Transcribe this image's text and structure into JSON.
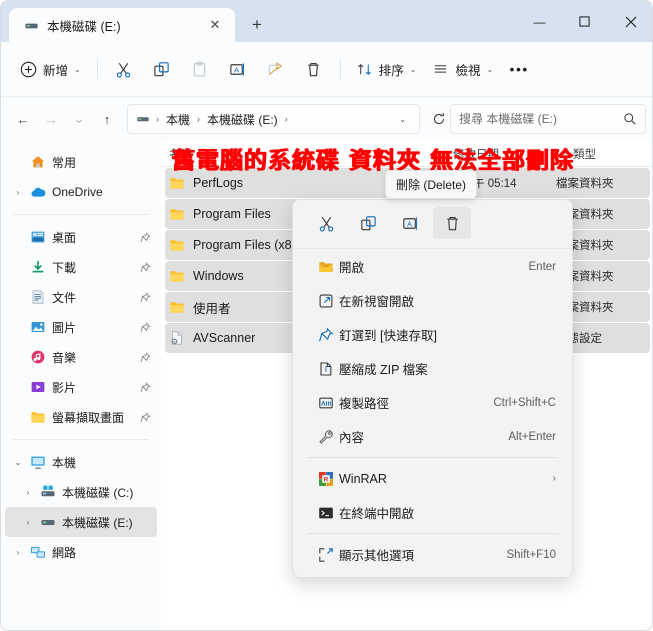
{
  "window": {
    "tab_title": "本機磁碟 (E:)",
    "tab_icon": "drive-icon",
    "close_tab_label": "✕",
    "new_tab_label": "+",
    "minimize_label": "—",
    "maximize_label": "☐",
    "close_label": "✕"
  },
  "toolbar": {
    "new_label": "新增",
    "cut_icon": "scissors-icon",
    "copy_icon": "copy-icon",
    "paste_icon": "paste-icon",
    "rename_icon": "rename-icon",
    "share_icon": "share-icon",
    "delete_icon": "trash-icon",
    "sort_label": "排序",
    "view_label": "檢視",
    "more_label": "•••",
    "caret": "⌄"
  },
  "address": {
    "back": "←",
    "forward": "→",
    "recent": "⌄",
    "up": "↑",
    "crumbs": [
      "本機",
      "本機磁碟 (E:)"
    ],
    "crumb_sep": "›",
    "dropdown": "⌄",
    "refresh": "⟳",
    "search_placeholder": "搜尋 本機磁碟 (E:)",
    "search_value": "",
    "search_icon": "magnifier-icon"
  },
  "sidebar": {
    "groups": [
      {
        "items": [
          {
            "label": "常用",
            "icon": "home-icon",
            "chevron": "",
            "pin": false,
            "selected": false,
            "indent": 0
          },
          {
            "label": "OneDrive",
            "icon": "onedrive-icon",
            "chevron": "›",
            "pin": false,
            "selected": false,
            "indent": 0
          }
        ]
      },
      {
        "items": [
          {
            "label": "桌面",
            "icon": "desktop-icon",
            "chevron": "",
            "pin": true,
            "selected": false,
            "indent": 0
          },
          {
            "label": "下載",
            "icon": "download-icon",
            "chevron": "",
            "pin": true,
            "selected": false,
            "indent": 0
          },
          {
            "label": "文件",
            "icon": "documents-icon",
            "chevron": "",
            "pin": true,
            "selected": false,
            "indent": 0
          },
          {
            "label": "圖片",
            "icon": "pictures-icon",
            "chevron": "",
            "pin": true,
            "selected": false,
            "indent": 0
          },
          {
            "label": "音樂",
            "icon": "music-icon",
            "chevron": "",
            "pin": true,
            "selected": false,
            "indent": 0
          },
          {
            "label": "影片",
            "icon": "videos-icon",
            "chevron": "",
            "pin": true,
            "selected": false,
            "indent": 0
          },
          {
            "label": "螢幕擷取畫面",
            "icon": "folder-icon",
            "chevron": "",
            "pin": true,
            "selected": false,
            "indent": 0
          }
        ]
      },
      {
        "items": [
          {
            "label": "本機",
            "icon": "thispc-icon",
            "chevron": "⌄",
            "pin": false,
            "selected": false,
            "indent": 0
          },
          {
            "label": "本機磁碟 (C:)",
            "icon": "windrive-icon",
            "chevron": "›",
            "pin": false,
            "selected": false,
            "indent": 1
          },
          {
            "label": "本機磁碟 (E:)",
            "icon": "drive-icon",
            "chevron": "›",
            "pin": false,
            "selected": true,
            "indent": 1
          },
          {
            "label": "網路",
            "icon": "network-icon",
            "chevron": "›",
            "pin": false,
            "selected": false,
            "indent": 0
          }
        ]
      }
    ]
  },
  "filelist": {
    "columns": [
      "名稱",
      "修改日期",
      "類型"
    ],
    "rows": [
      {
        "name": "PerfLogs",
        "icon": "folder-icon",
        "date": "12/7 下午 05:14",
        "type": "檔案資料夾",
        "selected": true
      },
      {
        "name": "Program Files",
        "icon": "folder-icon",
        "date": "",
        "type": "檔案資料夾",
        "selected": true
      },
      {
        "name": "Program Files (x86)",
        "icon": "folder-icon",
        "date": "",
        "type": "檔案資料夾",
        "selected": true
      },
      {
        "name": "Windows",
        "icon": "folder-icon",
        "date": "",
        "type": "檔案資料夾",
        "selected": true
      },
      {
        "name": "使用者",
        "icon": "folder-icon",
        "date": "",
        "type": "檔案資料夾",
        "selected": true
      },
      {
        "name": "AVScanner",
        "icon": "config-file-icon",
        "date": "",
        "type": "組態設定",
        "selected": true
      }
    ]
  },
  "annotation": {
    "text": "舊電腦的系統碟 資料夾 無法全部刪除",
    "color": "#ff0000"
  },
  "tooltip": {
    "text": "刪除 (Delete)"
  },
  "context_menu": {
    "tools": [
      {
        "icon": "scissors-icon",
        "name": "cut"
      },
      {
        "icon": "copy-icon",
        "name": "copy"
      },
      {
        "icon": "rename-icon",
        "name": "rename"
      },
      {
        "icon": "trash-icon",
        "name": "delete"
      }
    ],
    "items": [
      {
        "label": "開啟",
        "icon": "folder-open-icon",
        "accel": "Enter",
        "submenu": false
      },
      {
        "label": "在新視窗開啟",
        "icon": "new-window-icon",
        "accel": "",
        "submenu": false
      },
      {
        "label": "釘選到 [快速存取]",
        "icon": "pin-icon",
        "accel": "",
        "submenu": false
      },
      {
        "label": "壓縮成 ZIP 檔案",
        "icon": "zip-icon",
        "accel": "",
        "submenu": false
      },
      {
        "label": "複製路徑",
        "icon": "copy-path-icon",
        "accel": "Ctrl+Shift+C",
        "submenu": false
      },
      {
        "label": "內容",
        "icon": "wrench-icon",
        "accel": "Alt+Enter",
        "submenu": false
      },
      {
        "label": "WinRAR",
        "icon": "winrar-icon",
        "accel": "",
        "submenu": true,
        "divider_before": true
      },
      {
        "label": "在終端中開啟",
        "icon": "terminal-icon",
        "accel": "",
        "submenu": false
      },
      {
        "label": "顯示其他選項",
        "icon": "more-options-icon",
        "accel": "Shift+F10",
        "submenu": false,
        "divider_before": true
      }
    ]
  }
}
